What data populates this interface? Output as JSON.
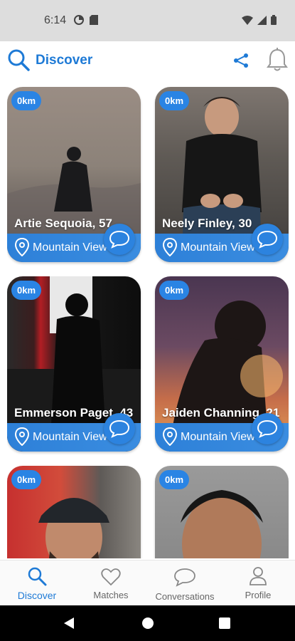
{
  "status_bar": {
    "time": "6:14"
  },
  "app_bar": {
    "title": "Discover"
  },
  "colors": {
    "accent": "#1e7ad6",
    "card_footer": "#2d80d8",
    "badge": "#2a84e4"
  },
  "cards": [
    {
      "distance": "0km",
      "name": "Artie Sequoia, 57",
      "location": "Mountain View"
    },
    {
      "distance": "0km",
      "name": "Neely Finley, 30",
      "location": "Mountain View"
    },
    {
      "distance": "0km",
      "name": "Emmerson Paget, 43",
      "location": "Mountain View"
    },
    {
      "distance": "0km",
      "name": "Jaiden Channing, 21",
      "location": "Mountain View"
    },
    {
      "distance": "0km",
      "name": "",
      "location": ""
    },
    {
      "distance": "0km",
      "name": "",
      "location": ""
    }
  ],
  "bottom_nav": {
    "discover": "Discover",
    "matches": "Matches",
    "conversations": "Conversations",
    "profile": "Profile"
  }
}
